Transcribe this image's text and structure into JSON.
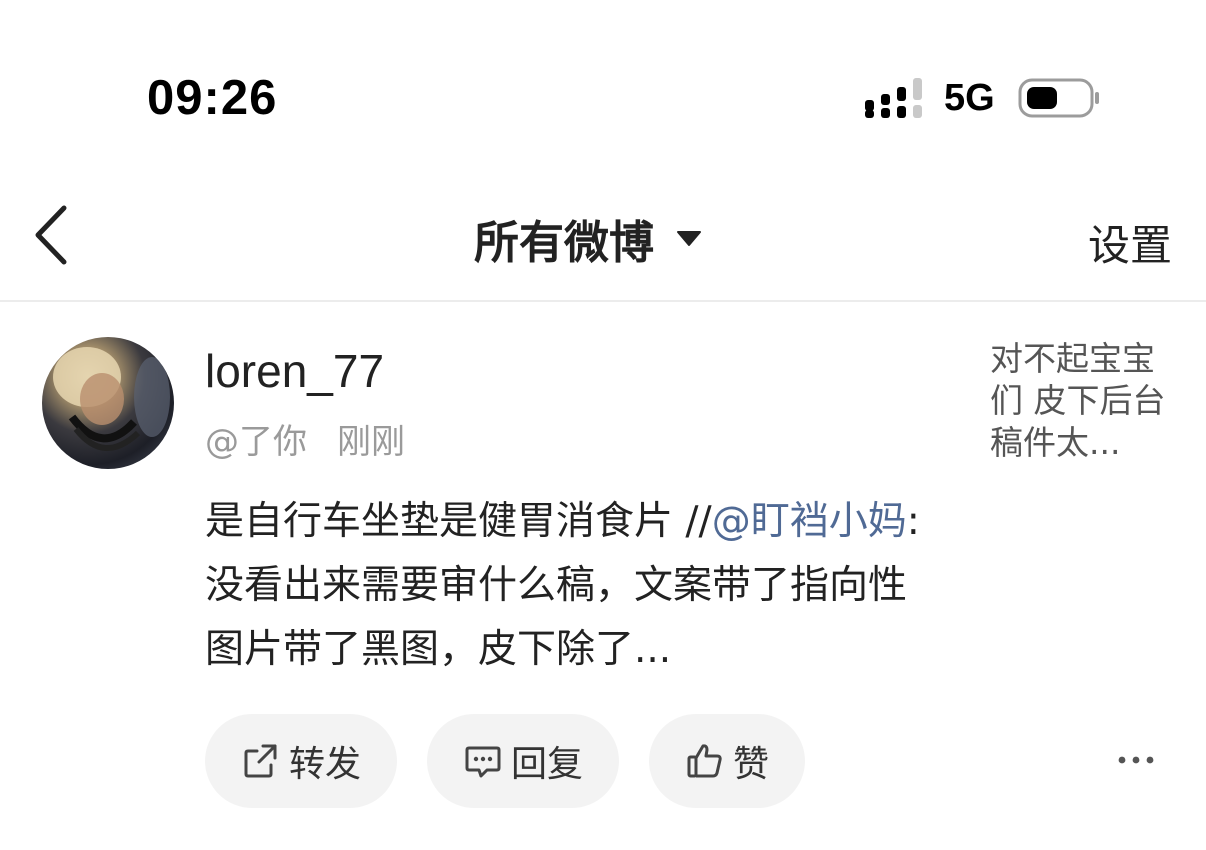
{
  "status_bar": {
    "time": "09:26",
    "network": "5G",
    "signal_icon": "signal-bars-icon",
    "battery_icon": "battery-icon"
  },
  "nav": {
    "back_icon": "chevron-left-icon",
    "title": "所有微博",
    "dropdown_icon": "caret-down-icon",
    "settings_label": "设置"
  },
  "post": {
    "username": "loren_77",
    "source": "@了你",
    "time_ago": "刚刚",
    "side_text": "对不起宝宝们 皮下后台稿件太...",
    "content_prefix": "是自行车坐垫是健胃消食片 //",
    "mention": "@盯裆小妈",
    "content_suffix": ":没看出来需要审什么稿，文案带了指向性图片带了黑图，皮下除了...",
    "actions": {
      "repost_label": "转发",
      "reply_label": "回复",
      "like_label": "赞"
    },
    "more_icon": "more-dots-icon"
  },
  "colors": {
    "mention": "#506a95",
    "meta_gray": "#9a9a9a",
    "pill_bg": "#f3f3f3"
  }
}
